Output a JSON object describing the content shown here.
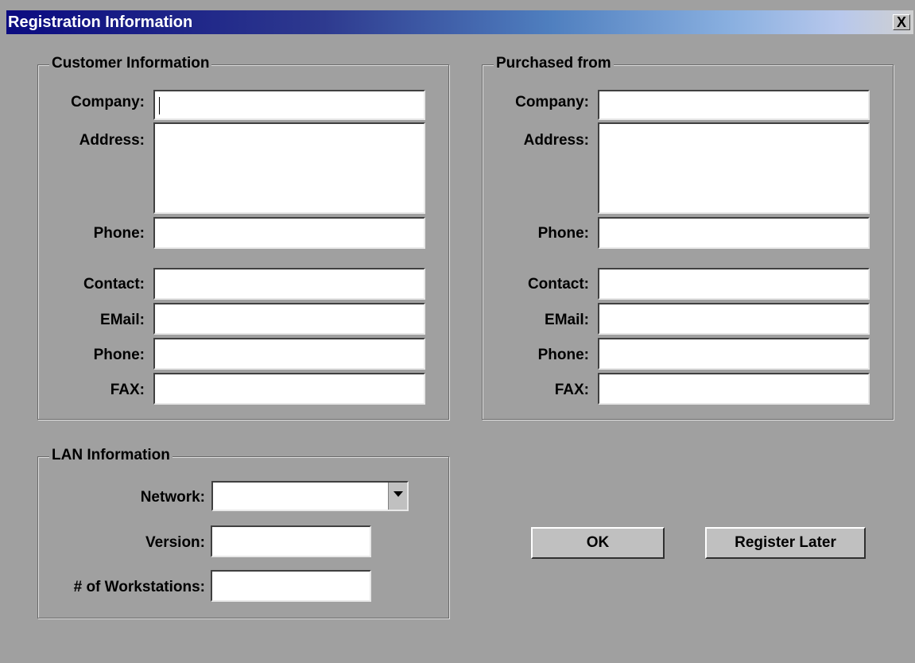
{
  "window": {
    "title": "Registration Information",
    "close_label": "X"
  },
  "customer": {
    "group_title": "Customer Information",
    "labels": {
      "company": "Company:",
      "address": "Address:",
      "phone": "Phone:",
      "contact": "Contact:",
      "email": "EMail:",
      "phone2": "Phone:",
      "fax": "FAX:"
    },
    "values": {
      "company": "",
      "address": "",
      "phone": "",
      "contact": "",
      "email": "",
      "phone2": "",
      "fax": ""
    }
  },
  "purchased": {
    "group_title": "Purchased from",
    "labels": {
      "company": "Company:",
      "address": "Address:",
      "phone": "Phone:",
      "contact": "Contact:",
      "email": "EMail:",
      "phone2": "Phone:",
      "fax": "FAX:"
    },
    "values": {
      "company": "",
      "address": "",
      "phone": "",
      "contact": "",
      "email": "",
      "phone2": "",
      "fax": ""
    }
  },
  "lan": {
    "group_title": "LAN Information",
    "labels": {
      "network": "Network:",
      "version": "Version:",
      "workstations": "# of Workstations:"
    },
    "values": {
      "network": "",
      "version": "",
      "workstations": ""
    }
  },
  "buttons": {
    "ok": "OK",
    "register_later": "Register Later"
  }
}
